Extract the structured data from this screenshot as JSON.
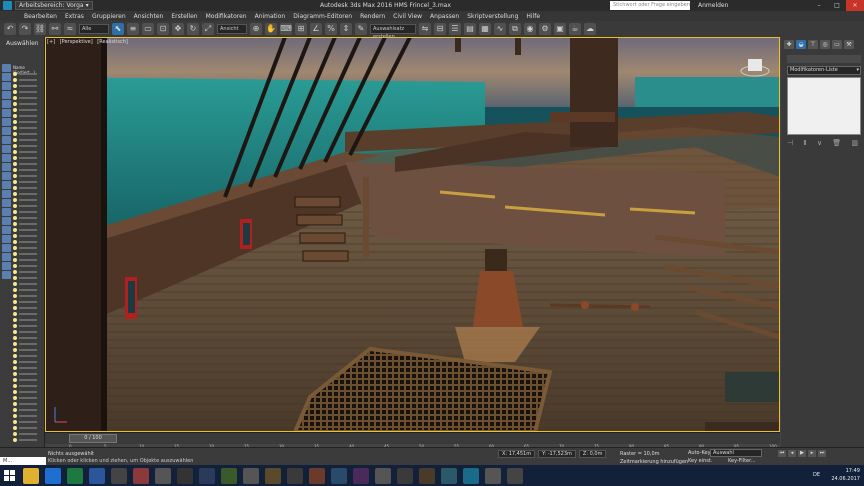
{
  "title_bar": {
    "workspace_label": "Arbeitsbereich: Vorga",
    "window_title": "Autodesk 3ds Max 2016   HMS Frincel_3.max",
    "search_placeholder": "Stichwort oder Frage eingeben",
    "sign_in": "Anmelden"
  },
  "menu": [
    "Bearbeiten",
    "Extras",
    "Gruppieren",
    "Ansichten",
    "Erstellen",
    "Modifikatoren",
    "Animation",
    "Diagramm-Editoren",
    "Rendern",
    "Civil View",
    "Anpassen",
    "Skriptverstellung",
    "Hilfe"
  ],
  "toolbar": {
    "filter_value": "Alle",
    "coord_value": "Ansicht",
    "named_selection_placeholder": "Auswahlsatz erstellen"
  },
  "left_panel": {
    "header": "Auswählen",
    "column_label": "Name (Sortiert...)"
  },
  "viewport": {
    "labels": [
      "[+]",
      "[Perspektive]",
      "[Realistisch]"
    ]
  },
  "right_panel": {
    "modifier_list": "Modifikatoren-Liste"
  },
  "timeline": {
    "frame_slider": "0 / 100",
    "ticks": [
      "0",
      "5",
      "10",
      "15",
      "20",
      "25",
      "30",
      "35",
      "40",
      "45",
      "50",
      "55",
      "60",
      "65",
      "70",
      "75",
      "80",
      "85",
      "90",
      "95",
      "100"
    ]
  },
  "status": {
    "selection_text": "Nichts ausgewählt",
    "hint_text": "Klicken oder klicken und ziehen, um Objekte auszuwählen",
    "x_value": "X: 17,451m",
    "y_value": "Y: -17,523m",
    "z_value": "Z: 0,0m",
    "grid_value": "Raster = 10,0m",
    "add_time_tag": "Zeitmarkierung hinzufügen",
    "auto_key": "Auto-Key",
    "auto_key_select": "Auswahl",
    "set_key": "Key einst.",
    "key_filters": "Key-Filter...",
    "command_input": "M..."
  },
  "taskbar": {
    "lang": "DE",
    "time": "17:49",
    "date": "24.06.2017"
  },
  "colors": {
    "accent": "#2f6fa8",
    "sea": "#1f8a87",
    "deck": "#5e4a35",
    "taskbar": "#12203a",
    "close": "#c8342a"
  }
}
